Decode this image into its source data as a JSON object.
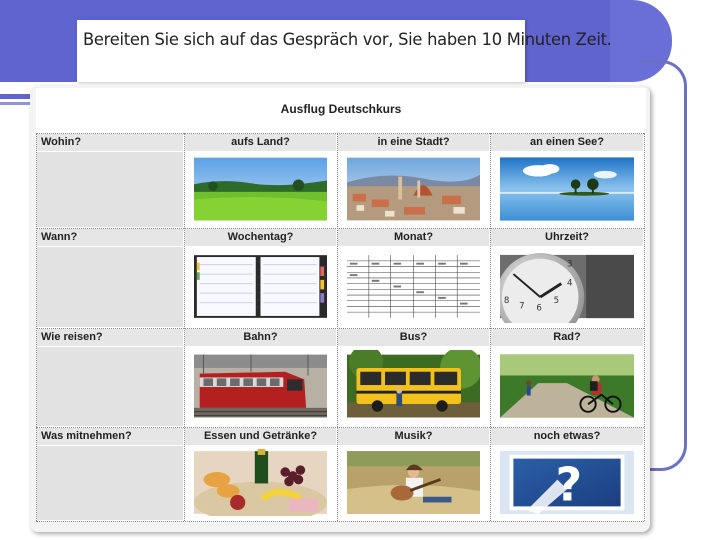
{
  "heading": "Bereiten Sie sich auf das Gespräch vor, Sie haben 10 Minuten Zeit.",
  "table": {
    "title": "Ausflug Deutschkurs",
    "rows": [
      {
        "question": "Wohin?",
        "options": [
          "aufs Land?",
          "in eine Stadt?",
          "an einen See?"
        ]
      },
      {
        "question": "Wann?",
        "options": [
          "Wochentag?",
          "Monat?",
          "Uhrzeit?"
        ]
      },
      {
        "question": "Wie reisen?",
        "options": [
          "Bahn?",
          "Bus?",
          "Rad?"
        ]
      },
      {
        "question": "Was mitnehmen?",
        "options": [
          "Essen und Getränke?",
          "Musik?",
          "noch etwas?"
        ]
      }
    ],
    "images": [
      [
        "countryside-photo",
        "city-photo",
        "lake-photo"
      ],
      [
        "weekday-planner-photo",
        "month-calendar-photo",
        "clock-photo"
      ],
      [
        "train-photo",
        "bus-photo",
        "cyclist-photo"
      ],
      [
        "picnic-food-photo",
        "guitar-music-photo",
        "question-mark-sign-photo"
      ]
    ]
  },
  "colors": {
    "accent": "#5f64cf",
    "header_row": "#e6e6e6",
    "empty_cell": "#e2e2e2"
  }
}
